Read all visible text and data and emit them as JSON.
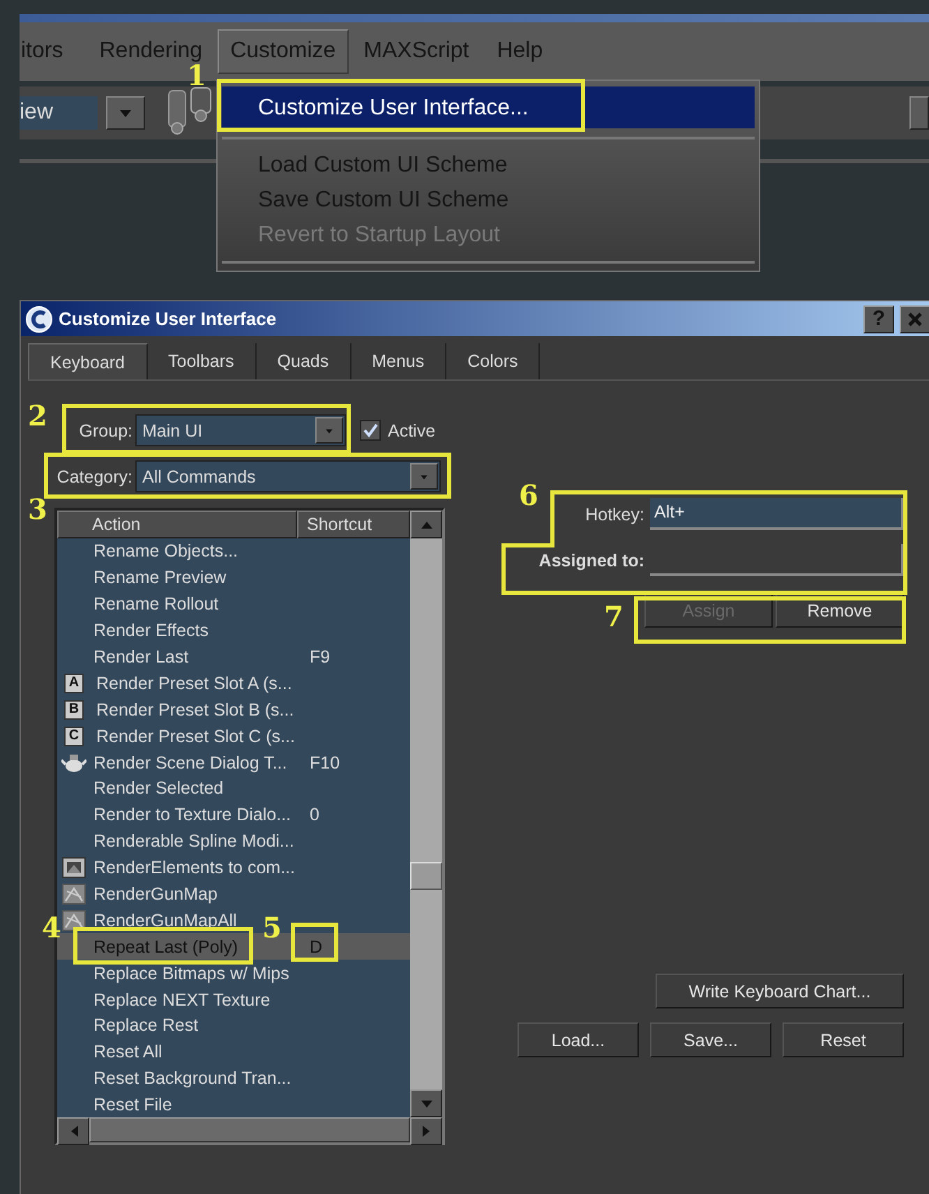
{
  "menubar": {
    "items": [
      {
        "label": "itors",
        "selected": false
      },
      {
        "label": "Rendering",
        "selected": false
      },
      {
        "label": "Customize",
        "selected": true
      },
      {
        "label": "MAXScript",
        "selected": false
      },
      {
        "label": "Help",
        "selected": false
      }
    ]
  },
  "toolbar": {
    "view_field": "iew"
  },
  "menu": {
    "items": [
      {
        "kind": "item",
        "label": "Customize User Interface...",
        "selected": true,
        "disabled": false
      },
      {
        "kind": "separator"
      },
      {
        "kind": "item",
        "label": "Load Custom UI Scheme",
        "selected": false,
        "disabled": false
      },
      {
        "kind": "item",
        "label": "Save Custom UI Scheme",
        "selected": false,
        "disabled": false
      },
      {
        "kind": "item",
        "label": "Revert to Startup Layout",
        "selected": false,
        "disabled": true
      },
      {
        "kind": "separator"
      }
    ]
  },
  "dialog": {
    "title": "Customize User Interface",
    "help_button": "?",
    "tabs": [
      {
        "label": "Keyboard",
        "selected": true
      },
      {
        "label": "Toolbars",
        "selected": false
      },
      {
        "label": "Quads",
        "selected": false
      },
      {
        "label": "Menus",
        "selected": false
      },
      {
        "label": "Colors",
        "selected": false
      }
    ],
    "group": {
      "label": "Group:",
      "value": "Main UI"
    },
    "active": {
      "label": "Active",
      "checked": true
    },
    "category": {
      "label": "Category:",
      "value": "All Commands"
    },
    "list": {
      "columns": [
        "Action",
        "Shortcut"
      ],
      "rows": [
        {
          "action": "Rename Objects...",
          "selected": false
        },
        {
          "action": "Rename Preview",
          "selected": false
        },
        {
          "action": "Rename Rollout",
          "selected": false
        },
        {
          "action": "Render Effects",
          "selected": false
        },
        {
          "action": "Render Last",
          "shortcut": "F9",
          "selected": false
        },
        {
          "kind": "slot",
          "badge": "A",
          "action": "Render Preset Slot A (s...",
          "selected": false
        },
        {
          "kind": "slot",
          "badge": "B",
          "action": "Render Preset Slot B (s...",
          "selected": false
        },
        {
          "kind": "slot",
          "badge": "C",
          "action": "Render Preset Slot C (s...",
          "selected": false
        },
        {
          "kind": "teapot",
          "action": "Render Scene Dialog T...",
          "shortcut": "F10",
          "selected": false
        },
        {
          "action": "Render Selected",
          "selected": false
        },
        {
          "action": "Render to Texture Dialo...",
          "shortcut": "0",
          "selected": false
        },
        {
          "action": "Renderable Spline Modi...",
          "selected": false
        },
        {
          "kind": "elements",
          "action": "RenderElements to com...",
          "selected": false
        },
        {
          "kind": "texture",
          "action": "RenderGunMap",
          "selected": false
        },
        {
          "kind": "texture",
          "action": "RenderGunMapAll",
          "selected": false
        },
        {
          "action": "Repeat Last (Poly)",
          "shortcut": "D",
          "selected": true
        },
        {
          "action": "Replace Bitmaps w/ Mips",
          "selected": false
        },
        {
          "action": "Replace NEXT Texture",
          "selected": false
        },
        {
          "action": "Replace Rest",
          "selected": false
        },
        {
          "action": "Reset All",
          "selected": false
        },
        {
          "action": "Reset Background Tran...",
          "selected": false
        },
        {
          "action": "Reset File",
          "selected": false
        }
      ]
    },
    "hotkey": {
      "label": "Hotkey:",
      "value": "Alt+"
    },
    "assigned_to": {
      "label": "Assigned to:"
    },
    "buttons": [
      {
        "label": "Assign",
        "disabled": true
      },
      {
        "label": "Remove",
        "disabled": false
      }
    ],
    "write_chart_button": "Write Keyboard Chart...",
    "file_buttons": [
      "Load...",
      "Save...",
      "Reset"
    ]
  },
  "annotations": [
    {
      "number": "1"
    },
    {
      "number": "2"
    },
    {
      "number": "3"
    },
    {
      "number": "4"
    },
    {
      "number": "5"
    },
    {
      "number": "6"
    },
    {
      "number": "7"
    }
  ]
}
